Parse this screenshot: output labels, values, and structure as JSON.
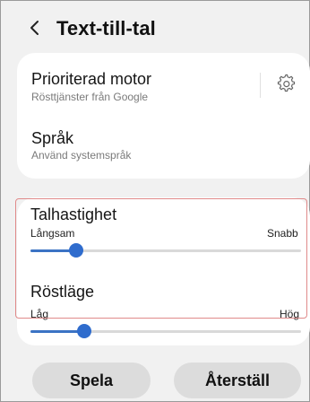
{
  "header": {
    "title": "Text-till-tal"
  },
  "engine": {
    "label": "Prioriterad motor",
    "sub": "Rösttjänster från Google"
  },
  "language": {
    "label": "Språk",
    "sub": "Använd systemspråk"
  },
  "speech_rate": {
    "label": "Talhastighet",
    "min_label": "Långsam",
    "max_label": "Snabb",
    "value": 0.17
  },
  "pitch": {
    "label": "Röstläge",
    "min_label": "Låg",
    "max_label": "Hög",
    "value": 0.2
  },
  "buttons": {
    "play": "Spela",
    "reset": "Återställ"
  },
  "colors": {
    "accent": "#2f6ccd",
    "highlight_border": "#e08a8a"
  },
  "icons": {
    "back": "chevron-left-icon",
    "settings": "gear-icon"
  }
}
